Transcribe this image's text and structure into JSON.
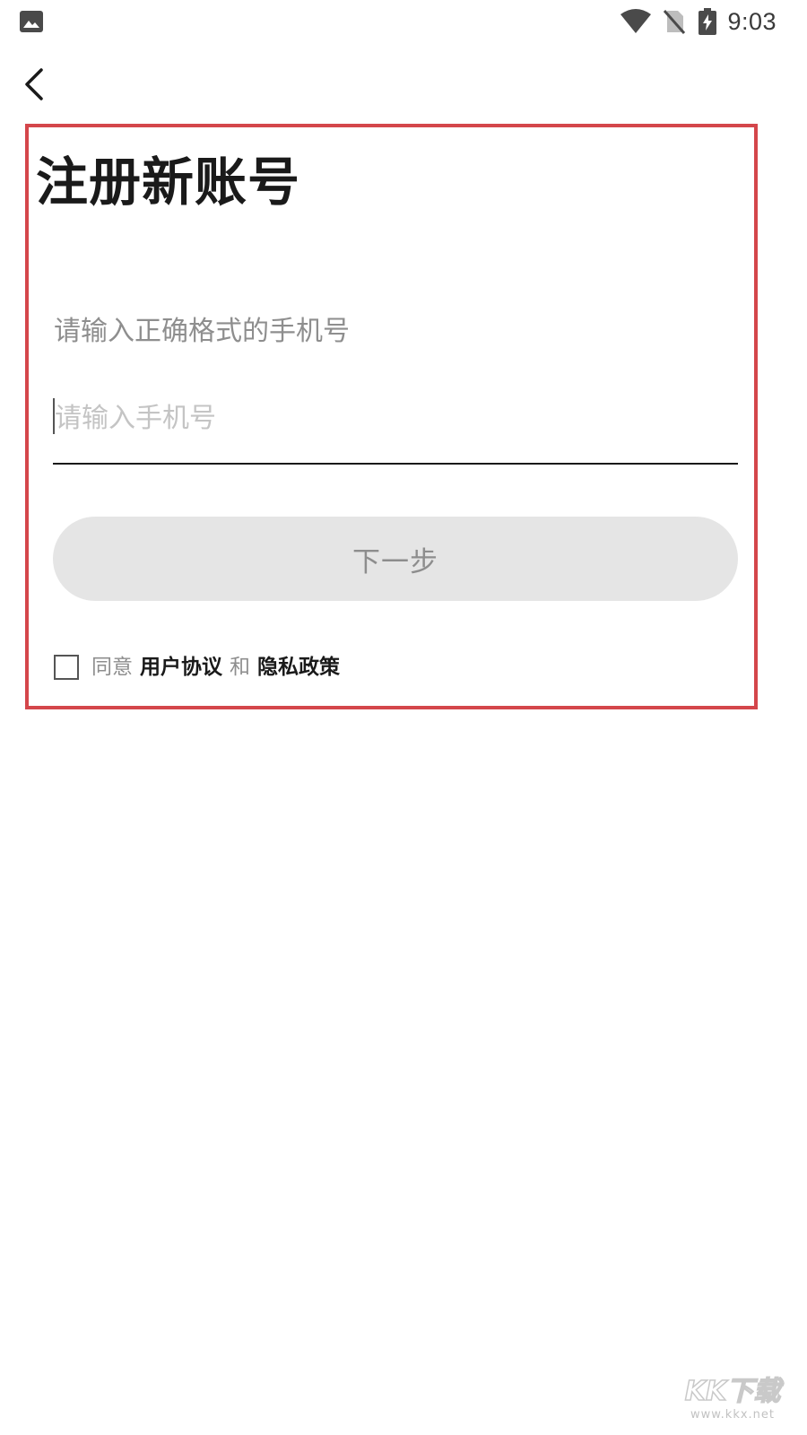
{
  "status_bar": {
    "time": "9:03",
    "icons": [
      "gallery-icon",
      "wifi-icon",
      "no-sim-icon",
      "battery-charging-icon"
    ]
  },
  "nav": {
    "back_icon": "chevron-left-icon"
  },
  "register": {
    "title": "注册新账号",
    "hint": "请输入正确格式的手机号",
    "phone_placeholder": "请输入手机号",
    "phone_value": "",
    "next_label": "下一步"
  },
  "agreement": {
    "checked": false,
    "agree_label": "同意",
    "user_agreement": "用户协议",
    "and_label": "和",
    "privacy_policy": "隐私政策"
  },
  "watermark": {
    "logo": "KK下载",
    "url": "www.kkx.net"
  },
  "colors": {
    "highlight_border": "#d4464b",
    "button_bg": "#e5e5e5",
    "button_text": "#8d8d8d",
    "hint_text": "#8e8e8e",
    "title_text": "#1a1a1a"
  }
}
